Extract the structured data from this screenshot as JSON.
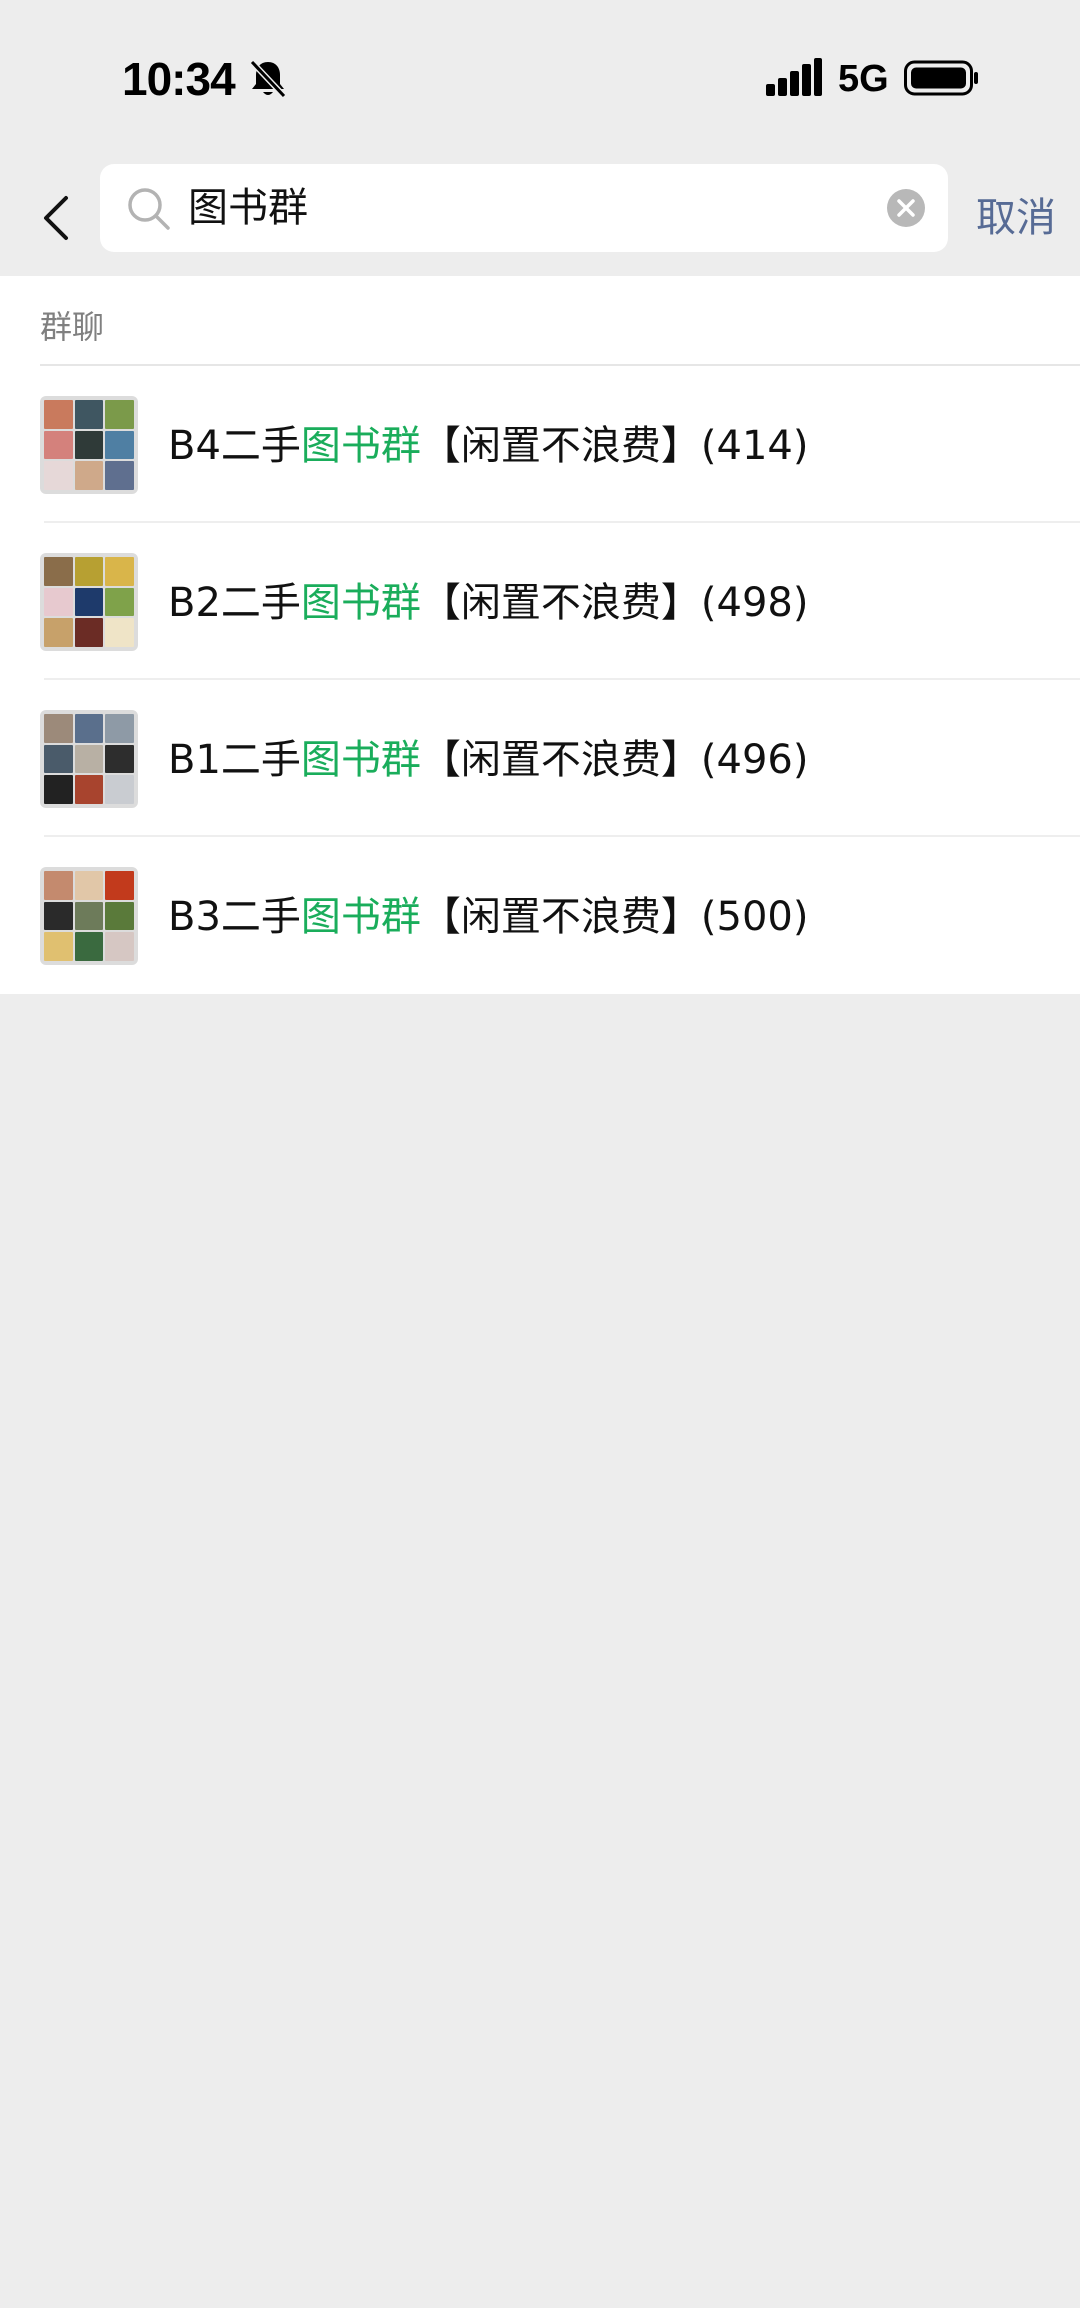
{
  "status": {
    "time": "10:34",
    "network": "5G"
  },
  "search": {
    "query": "图书群",
    "cancel_label": "取消"
  },
  "results": {
    "section_title": "群聊",
    "highlight": "图书群",
    "items": [
      {
        "prefix": "B4二手",
        "match": "图书群",
        "suffix": "【闲置不浪费】(414)"
      },
      {
        "prefix": "B2二手",
        "match": "图书群",
        "suffix": "【闲置不浪费】(498)"
      },
      {
        "prefix": "B1二手",
        "match": "图书群",
        "suffix": "【闲置不浪费】(496)"
      },
      {
        "prefix": "B3二手",
        "match": "图书群",
        "suffix": "【闲置不浪费】(500)"
      }
    ]
  },
  "colors": {
    "background": "#ededed",
    "highlight": "#1aad5b",
    "cancel": "#576b95"
  },
  "icons": [
    "bell-off-icon",
    "signal-icon",
    "battery-icon",
    "back-chevron-icon",
    "search-icon",
    "clear-icon"
  ]
}
